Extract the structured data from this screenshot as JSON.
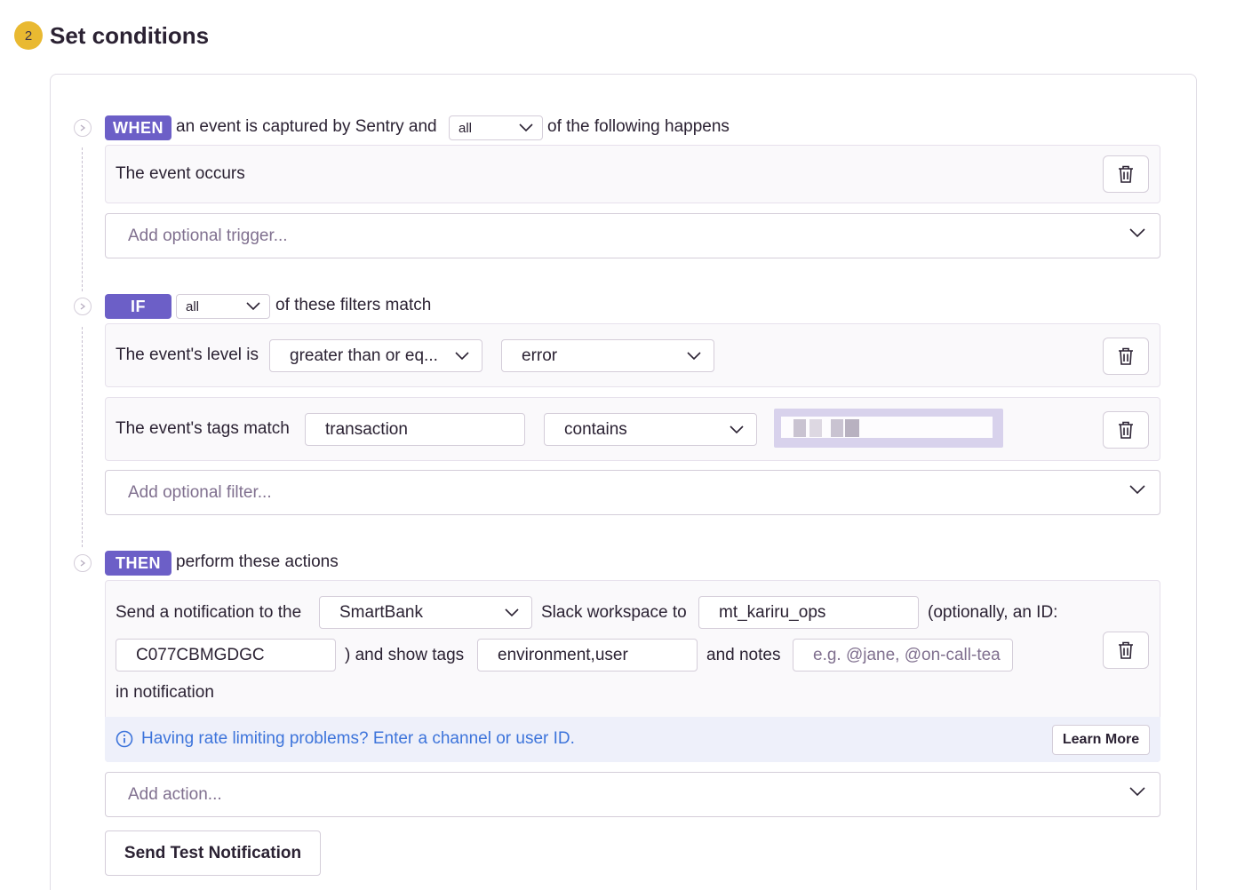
{
  "step": {
    "number": "2",
    "title": "Set conditions"
  },
  "when": {
    "badge": "WHEN",
    "prefix": "an event is captured by Sentry and",
    "match_select": "all",
    "suffix": "of the following happens",
    "trigger_row": "The event occurs",
    "add_placeholder": "Add optional trigger..."
  },
  "if": {
    "badge": "IF",
    "match_select": "all",
    "suffix": "of these filters match",
    "level_row": {
      "label": "The event's level is",
      "operator": "greater than or eq...",
      "level": "error"
    },
    "tags_row": {
      "label": "The event's tags match",
      "key": "transaction",
      "operator": "contains"
    },
    "add_placeholder": "Add optional filter..."
  },
  "then": {
    "badge": "THEN",
    "suffix": "perform these actions",
    "action": {
      "label_send": "Send a notification to the",
      "workspace": "SmartBank",
      "label_workspace": "Slack workspace to",
      "channel": "mt_kariru_ops",
      "label_optional": "(optionally, an ID:",
      "channel_id": "C077CBMGDGC",
      "label_tags": ") and show tags",
      "tags": "environment,user",
      "label_notes": "and notes",
      "notes_placeholder": "e.g. @jane, @on-call-tea",
      "label_end": "in notification"
    },
    "info": {
      "message": "Having rate limiting problems? Enter a channel or user ID.",
      "learn_more": "Learn More"
    },
    "add_placeholder": "Add action...",
    "test_button": "Send Test Notification"
  },
  "colors": {
    "badge": "#6c5fc7",
    "step_badge": "#e9b931",
    "info_text": "#3d74db",
    "info_bg": "#eef0fa"
  },
  "icons": [
    "chevron-down-icon",
    "trash-icon",
    "info-icon",
    "step-chevron-icon"
  ]
}
